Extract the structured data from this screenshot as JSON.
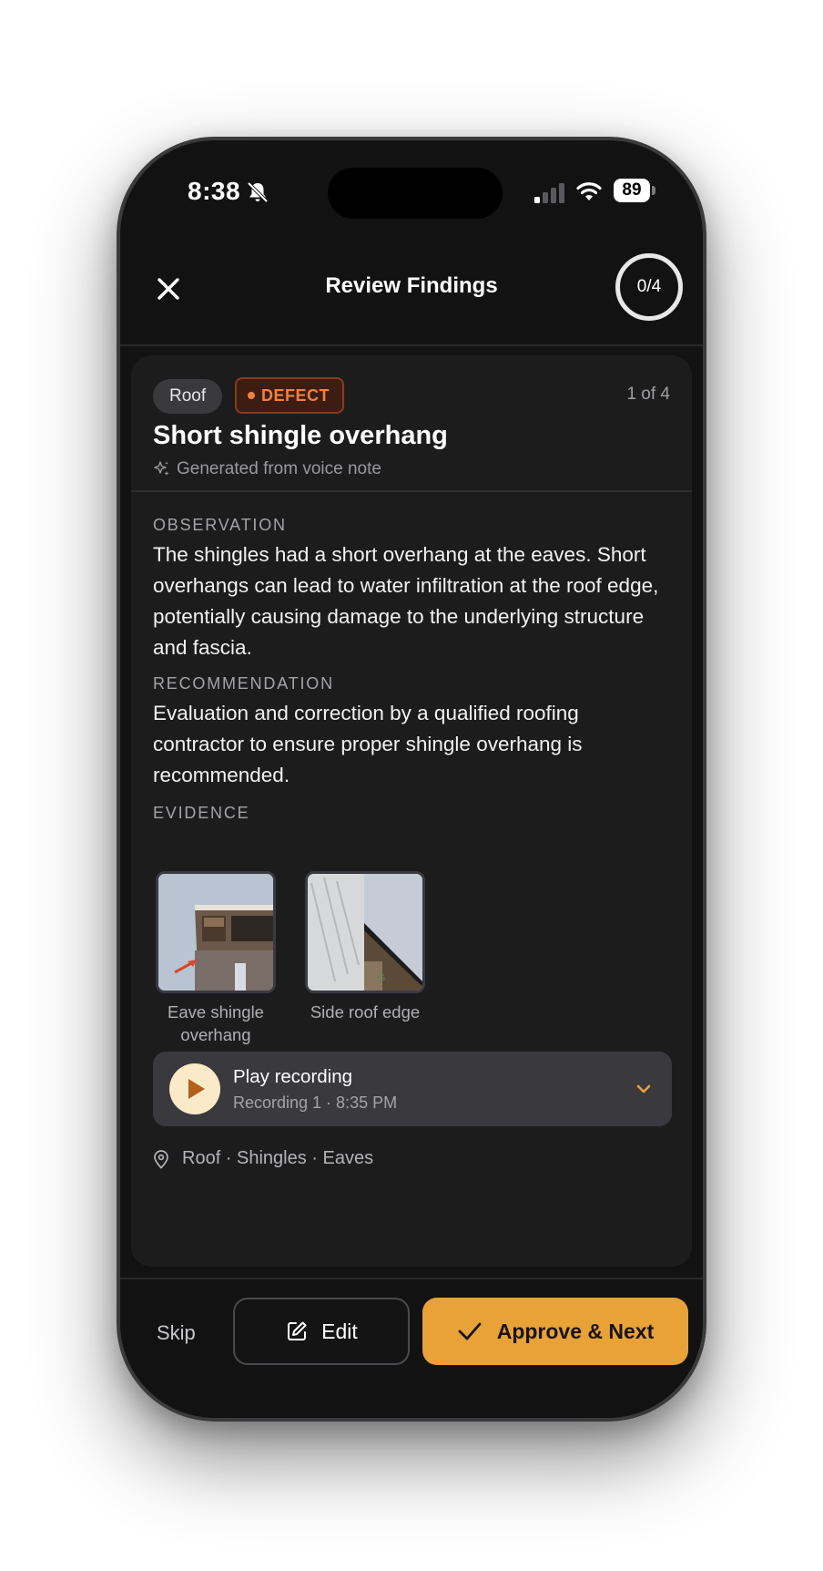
{
  "status_bar": {
    "time": "8:38",
    "battery": "89",
    "icons": [
      "bell-slash-icon",
      "signal-icon",
      "wifi-icon",
      "battery-icon"
    ]
  },
  "header": {
    "title": "Review Findings",
    "progress": "0/4",
    "close_icon": "close-icon"
  },
  "finding": {
    "category": "Roof",
    "severity": "DEFECT",
    "counter": "1 of 4",
    "title": "Short shingle overhang",
    "source": "Generated from voice note",
    "observation_label": "OBSERVATION",
    "observation": "The shingles had a short overhang at the eaves. Short overhangs can lead to water infiltration at the roof edge, potentially causing damage to the underlying structure and fascia.",
    "recommendation_label": "RECOMMENDATION",
    "recommendation": "Evaluation and correction by a qualified roofing contractor to ensure proper shingle overhang is recommended.",
    "evidence_label": "EVIDENCE",
    "evidence": [
      {
        "caption": "Eave shingle overhang"
      },
      {
        "caption": "Side roof edge"
      }
    ],
    "recording": {
      "title": "Play recording",
      "subtitle": "Recording 1 · 8:35 PM"
    },
    "location": "Roof · Shingles · Eaves"
  },
  "actions": {
    "skip": "Skip",
    "edit": "Edit",
    "approve": "Approve & Next"
  },
  "colors": {
    "accent": "#e8a238",
    "defect": "#f0823e",
    "background": "#121212",
    "card": "#1c1c1d"
  }
}
